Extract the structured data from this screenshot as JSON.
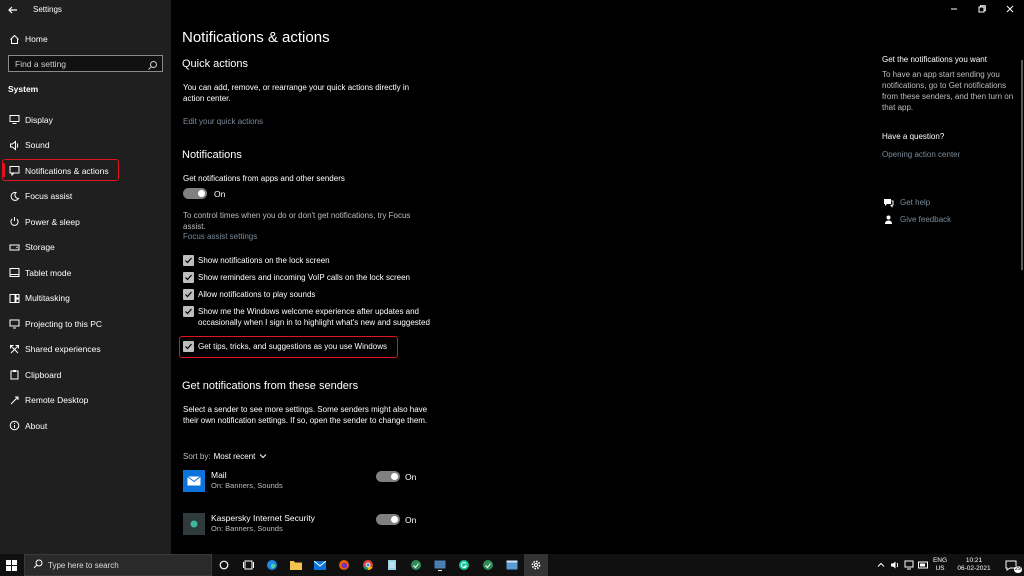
{
  "app": {
    "title": "Settings"
  },
  "sidebar": {
    "home": "Home",
    "search_placeholder": "Find a setting",
    "section": "System",
    "items": [
      {
        "label": "Display",
        "icon": "monitor-icon"
      },
      {
        "label": "Sound",
        "icon": "speaker-icon"
      },
      {
        "label": "Notifications & actions",
        "icon": "notification-icon"
      },
      {
        "label": "Focus assist",
        "icon": "moon-icon"
      },
      {
        "label": "Power & sleep",
        "icon": "power-icon"
      },
      {
        "label": "Storage",
        "icon": "storage-icon"
      },
      {
        "label": "Tablet mode",
        "icon": "tablet-icon"
      },
      {
        "label": "Multitasking",
        "icon": "multitasking-icon"
      },
      {
        "label": "Projecting to this PC",
        "icon": "projector-icon"
      },
      {
        "label": "Shared experiences",
        "icon": "shared-icon"
      },
      {
        "label": "Clipboard",
        "icon": "clipboard-icon"
      },
      {
        "label": "Remote Desktop",
        "icon": "remote-desktop-icon"
      },
      {
        "label": "About",
        "icon": "info-icon"
      }
    ]
  },
  "main": {
    "title": "Notifications & actions",
    "quick_actions": {
      "heading": "Quick actions",
      "text": "You can add, remove, or rearrange your quick actions directly in action center.",
      "link": "Edit your quick actions"
    },
    "notifications": {
      "heading": "Notifications",
      "get_label": "Get notifications from apps and other senders",
      "toggle_state": "On",
      "focus_text": "To control times when you do or don't get notifications, try Focus assist.",
      "focus_link": "Focus assist settings",
      "checks": [
        "Show notifications on the lock screen",
        "Show reminders and incoming VoIP calls on the lock screen",
        "Allow notifications to play sounds",
        "Show me the Windows welcome experience after updates and occasionally when I sign in to highlight what's new and suggested",
        "Get tips, tricks, and suggestions as you use Windows"
      ]
    },
    "senders": {
      "heading": "Get notifications from these senders",
      "text": "Select a sender to see more settings. Some senders might also have their own notification settings. If so, open the sender to change them.",
      "sort_label": "Sort by:",
      "sort_value": "Most recent",
      "list": [
        {
          "name": "Mail",
          "sub": "On: Banners, Sounds",
          "state": "On",
          "icon_color": "#0a74da"
        },
        {
          "name": "Kaspersky Internet Security",
          "sub": "On: Banners, Sounds",
          "state": "On",
          "icon_color": "#2f3b3b"
        }
      ]
    }
  },
  "right": {
    "title": "Get the notifications you want",
    "text": "To have an app start sending you notifications, go to Get notifications from these senders, and then turn on that app.",
    "question": "Have a question?",
    "question_link": "Opening action center",
    "help": "Get help",
    "feedback": "Give feedback"
  },
  "taskbar": {
    "search_placeholder": "Type here to search",
    "lang": "ENG",
    "region": "US",
    "time": "10:21",
    "date": "06-02-2021",
    "notif_count": "29"
  },
  "colors": {
    "accent_red": "#e0141e",
    "sidebar_bg": "#1f1f1f",
    "link": "#7a8a99"
  }
}
